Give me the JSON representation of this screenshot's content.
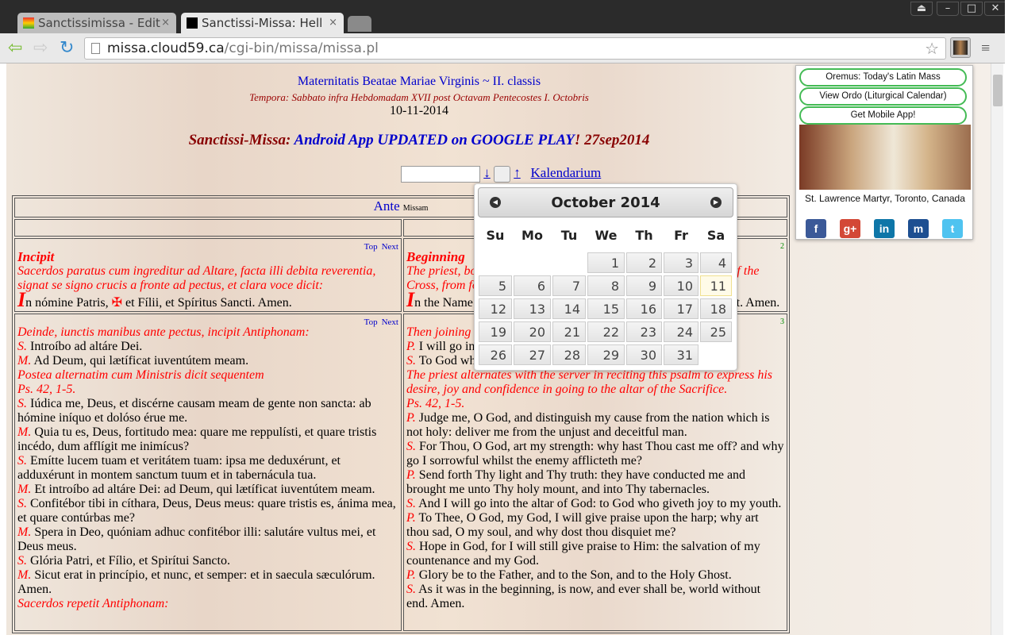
{
  "browser": {
    "tabs": [
      {
        "title": "Sanctissimissa - Edit"
      },
      {
        "title": "Sanctissi-Missa: Hell"
      }
    ],
    "close": "×",
    "url_domain": "missa.cloud59.ca",
    "url_path": "/cgi-bin/missa/missa.pl"
  },
  "header": {
    "feast": "Maternitatis Beatae Mariae Virginis ~ II. classis",
    "tempora": "Tempora: Sabbato infra Hebdomadam XVII post Octavam Pentecostes I. Octobris",
    "date": "10-11-2014",
    "ann_prefix": "Sanctissi-Missa: ",
    "ann_link": "Android App UPDATED on GOOGLE PLAY",
    "ann_suffix": "! 27sep2014"
  },
  "datebar": {
    "date_value": "",
    "down": "↓",
    "up": "↑",
    "kalendarium": "Kalendarium"
  },
  "ante": {
    "link": "Ante",
    "text": "Missam"
  },
  "sections": [
    {
      "top": "Top",
      "next": "Next",
      "num": "2",
      "left": {
        "title": "Incipit",
        "rubric": "Sacerdos paratus cum ingreditur ad Altare, facta illi debita reverentia, signat se signo crucis a fronte ad pectus, et clara voce dicit:",
        "initial": "I",
        "text1": "n nómine Patris, ",
        "cross": "✠",
        "text2": " et Fílii, et Spíritus Sancti. Amen."
      },
      "right": {
        "title": "Beginning",
        "rubric": "The priest, bowing down at the foot of the altar, makes the Sign of the Cross, from forehead to breast, and says:",
        "initial": "I",
        "text": "n the Name of the Father, and of the Son, and of the Holy Ghost. Amen."
      }
    },
    {
      "top": "Top",
      "next": "Next",
      "num": "3",
      "left": [
        [
          "r",
          "Deinde, iunctis manibus ante pectus, incipit Antiphonam:"
        ],
        [
          "S.",
          "Introíbo ad altáre Dei."
        ],
        [
          "M.",
          "Ad Deum, qui lætíficat iuventútem meam."
        ],
        [
          "r",
          "Postea alternatim cum Ministris dicit sequentem"
        ],
        [
          "r",
          "Ps. 42, 1-5."
        ],
        [
          "S.",
          "Iúdica me, Deus, et discérne causam meam de gente non sancta: ab hómine iníquo et dolóso érue me."
        ],
        [
          "M.",
          "Quia tu es, Deus, fortitudo mea: quare me reppulísti, et quare tristis incédo, dum afflígit me inimícus?"
        ],
        [
          "S.",
          "Emítte lucem tuam et veritátem tuam: ipsa me deduxérunt, et adduxérunt in montem sanctum tuum et in tabernácula tua."
        ],
        [
          "M.",
          "Et introíbo ad altáre Dei: ad Deum, qui lætíficat iuventútem meam."
        ],
        [
          "S.",
          "Confitébor tibi in cíthara, Deus, Deus meus: quare tristis es, ánima mea, et quare contúrbas me?"
        ],
        [
          "M.",
          "Spera in Deo, quóniam adhuc confitébor illi: salutáre vultus mei, et Deus meus."
        ],
        [
          "S.",
          "Glória Patri, et Fílio, et Spirítui Sancto."
        ],
        [
          "M.",
          "Sicut erat in princípio, et nunc, et semper: et in saecula sæculórum. Amen."
        ],
        [
          "r",
          "Sacerdos repetit Antiphonam:"
        ]
      ],
      "right": [
        [
          "r",
          "Then joining his hands before his breast, he begins the Antiphon:"
        ],
        [
          "P.",
          "I will go in unto the altar of God."
        ],
        [
          "S.",
          "To God who giveth joy to my youth."
        ],
        [
          "r",
          "The priest alternates with the server in reciting this psalm to express his desire, joy and confidence in going to the altar of the Sacrifice."
        ],
        [
          "r",
          "Ps. 42, 1-5."
        ],
        [
          "P.",
          "Judge me, O God, and distinguish my cause from the nation which is not holy: deliver me from the unjust and deceitful man."
        ],
        [
          "S.",
          "For Thou, O God, art my strength: why hast Thou cast me off? and why go I sorrowful whilst the enemy afflicteth me?"
        ],
        [
          "P.",
          "Send forth Thy light and Thy truth: they have conducted me and brought me unto Thy holy mount, and into Thy tabernacles."
        ],
        [
          "S.",
          "And I will go into the altar of God: to God who giveth joy to my youth."
        ],
        [
          "P.",
          "To Thee, O God, my God, I will give praise upon the harp; why art thou sad, O my soul, and why dost thou disquiet me?"
        ],
        [
          "S.",
          "Hope in God, for I will still give praise to Him: the salvation of my countenance and my God."
        ],
        [
          "P.",
          "Glory be to the Father, and to the Son, and to the Holy Ghost."
        ],
        [
          "S.",
          "As it was in the beginning, is now, and ever shall be, world without end. Amen."
        ]
      ]
    }
  ],
  "calendar": {
    "month": "October 2014",
    "prev": "◀",
    "next": "▶",
    "weekdays": [
      "Su",
      "Mo",
      "Tu",
      "We",
      "Th",
      "Fr",
      "Sa"
    ],
    "first_weekday": 3,
    "days": 31,
    "selected": 11
  },
  "extension": {
    "buttons": [
      "Oremus: Today's Latin Mass",
      "View Ordo (Liturgical Calendar)",
      "Get Mobile App!"
    ],
    "caption": "St. Lawrence Martyr, Toronto, Canada",
    "social": [
      {
        "name": "facebook",
        "glyph": "f",
        "color": "#3b5998"
      },
      {
        "name": "google-plus",
        "glyph": "g+",
        "color": "#d34836"
      },
      {
        "name": "linkedin",
        "glyph": "in",
        "color": "#0e76a8"
      },
      {
        "name": "myspace",
        "glyph": "m",
        "color": "#1d4f91"
      },
      {
        "name": "twitter",
        "glyph": "t",
        "color": "#4fc3f0"
      }
    ]
  }
}
